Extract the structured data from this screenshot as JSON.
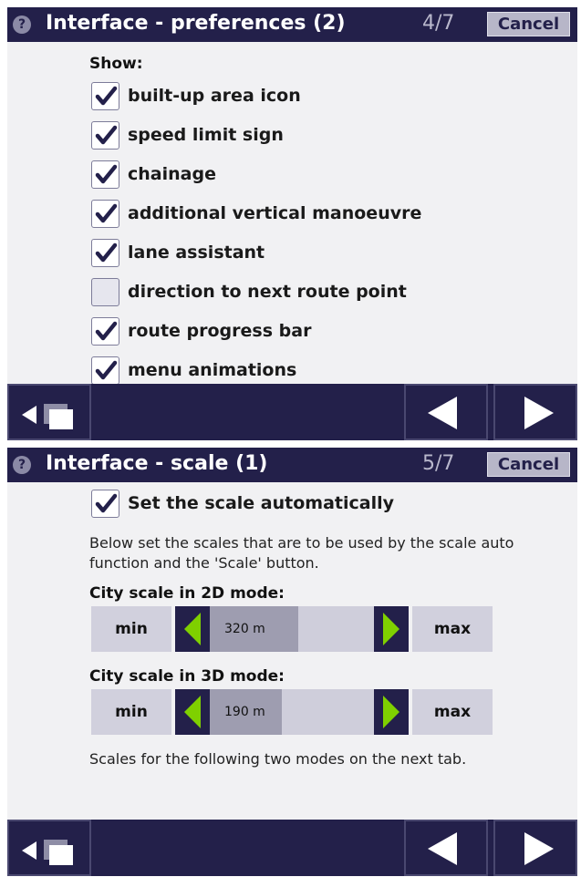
{
  "panels": [
    {
      "title": "Interface - preferences (2)",
      "page": "4/7",
      "cancel": "Cancel",
      "show_label": "Show:",
      "options": [
        {
          "label": "built-up area icon",
          "checked": true
        },
        {
          "label": "speed limit sign",
          "checked": true
        },
        {
          "label": "chainage",
          "checked": true
        },
        {
          "label": "additional vertical manoeuvre",
          "checked": true
        },
        {
          "label": "lane assistant",
          "checked": true
        },
        {
          "label": "direction to next route point",
          "checked": false
        },
        {
          "label": "route progress bar",
          "checked": true
        },
        {
          "label": "menu animations",
          "checked": true
        }
      ]
    },
    {
      "title": "Interface - scale (1)",
      "page": "5/7",
      "cancel": "Cancel",
      "auto_scale": {
        "label": "Set the scale automatically",
        "checked": true
      },
      "description": "Below set the scales that are to be used by the scale auto function and the 'Scale' button.",
      "scales": [
        {
          "label": "City scale in 2D mode:",
          "min": "min",
          "max": "max",
          "value": "320 m",
          "level": 0.34
        },
        {
          "label": "City scale in 3D mode:",
          "min": "min",
          "max": "max",
          "value": "190 m",
          "level": 0.24
        }
      ],
      "footer": "Scales for the following two modes on the next tab."
    }
  ],
  "icons": {
    "help": "question-mark-icon",
    "pages": "pages-back-icon",
    "prev": "triangle-left-icon",
    "next": "triangle-right-icon",
    "check": "checkmark-icon"
  },
  "colors": {
    "bar": "#23204a",
    "accent_green": "#7fd000",
    "checkmark": "#23204a"
  }
}
